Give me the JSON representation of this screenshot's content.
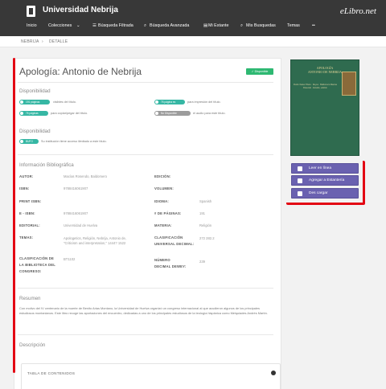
{
  "header": {
    "site": "Universidad Nebrija",
    "brand": "eLibro.net",
    "nav": [
      "Inicio",
      "Colecciones",
      "Búsqueda Filtrada",
      "Búsqueda Avanzada",
      "Mi Estante",
      "Mis Busquedas",
      "Temas"
    ]
  },
  "breadcrumb": [
    "NEBRIJA",
    "DETALLE"
  ],
  "book": {
    "title": "Apología: Antonio de Nebrija",
    "available": "Disponible",
    "sec_disponibilidad": "Disponibilidad",
    "pill_visible": "191 páginas",
    "txt_visible": "visibles del título.",
    "pill_print": "76 página es",
    "txt_print": "para impresión del título.",
    "pill_copy": "76 páginas",
    "txt_copy": "para copiar/pegar del título.",
    "pill_audio": "No Disponible",
    "txt_audio": "el audio para este título.",
    "sec_disponibilidad2": "Disponibilidad",
    "pill_access": "BUFO",
    "txt_access": "Su institución tiene acceso ilimitado a este título.",
    "sec_info": "Información Bibliográfica"
  },
  "fields": {
    "autor": {
      "label": "AUTOR:",
      "value": "Macías Rosendo, Baldomero"
    },
    "isbn": {
      "label": "ISBN:",
      "value": "9788416061907"
    },
    "print_isbn": {
      "label": "PRINT ISBN:",
      "value": ""
    },
    "eisbn": {
      "label": "E - ISBN:",
      "value": "9788416061907"
    },
    "editorial": {
      "label": "EDITORIAL:",
      "value": "Universidad de Huelva"
    },
    "temas": {
      "label": "TEMAS:",
      "value": "Apologetics, Religión, Nebrija, Antonio de, \"Criticism and interpretation,\" 1444? 1522"
    },
    "clasif_lc": {
      "label": "CLASIFICACIÓN DE LA BIBLIOTECA DEL CONGRESO:",
      "value": "BT1102"
    },
    "edicion": {
      "label": "EDICIÓN:",
      "value": ""
    },
    "volumen": {
      "label": "VOLUMEN:",
      "value": ""
    },
    "idioma": {
      "label": "IDIOMA:",
      "value": "Spanish"
    },
    "paginas": {
      "label": "# DE PÁGINAS:",
      "value": "191"
    },
    "materia": {
      "label": "MATERIA:",
      "value": "Religión"
    },
    "clasif_dewey": {
      "label": "CLASIFICACIÓN UNIVERSAL DECIMAL:",
      "value": "272 282.2"
    },
    "numero_dewey": {
      "label": "NÚMERO DECIMAL DEWEY:",
      "value": "239"
    }
  },
  "sec_resumen": "Resumen",
  "resumen": "Con motivo del IV centenario de la muerte de Benito Arias Montano, la Universidad de Huelva organizó un congreso internacional al que acudieron algunos de los principales estudiosos montanianos. Este libro recoge las aportaciones del encuentro, dedicadas a uno de los principales estudiosos de la teología hispánica como Melquiades Andrés Martín.",
  "sec_descripcion": "Descripción",
  "toc": "TABLA DE CONTENIDOS",
  "cover": {
    "title": "APOLOGÍA",
    "subtitle": "ANTONIO DE NEBRIJA",
    "credit": "Pedro Xavier Prieto · Reyes · Baldomero Macías Rosendo · Estudio, edición"
  },
  "actions": {
    "read": "Leer en línea",
    "shelf": "Agregar a Estantería",
    "download": "Des cargar"
  },
  "colors": {
    "header": "#383838",
    "accent_purple": "#6a61b0",
    "highlight_red": "#e30613",
    "pill_teal": "#36b7a4",
    "available_green": "#2eb872"
  }
}
